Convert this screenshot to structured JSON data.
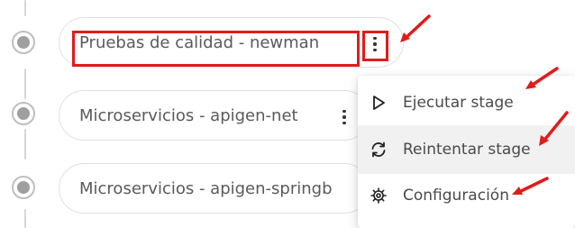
{
  "stages": [
    {
      "label": "Pruebas de calidad - newman"
    },
    {
      "label": "Microservicios - apigen-net"
    },
    {
      "label": "Microservicios - apigen-springb"
    }
  ],
  "menu": {
    "items": [
      {
        "label": "Ejecutar stage",
        "icon": "play-icon"
      },
      {
        "label": "Reintentar stage",
        "icon": "refresh-icon"
      },
      {
        "label": "Configuración",
        "icon": "gear-icon"
      }
    ]
  },
  "colors": {
    "annotation": "#e21b1b",
    "node": "#9f9f9f",
    "text": "#5a5a5a",
    "menu_hover": "#f1f1f1"
  }
}
